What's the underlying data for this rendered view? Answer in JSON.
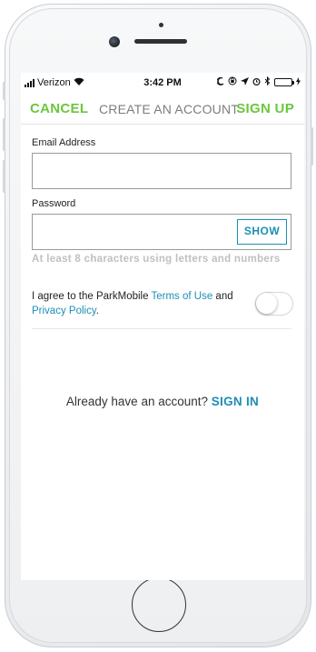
{
  "status_bar": {
    "carrier": "Verizon",
    "time": "3:42 PM",
    "icons": [
      "signal-bars-icon",
      "wifi-icon",
      "moon-icon",
      "lock-rotation-icon",
      "location-arrow-icon",
      "alarm-icon",
      "bluetooth-icon",
      "battery-icon",
      "charging-bolt-icon"
    ],
    "battery_color": "#4cd964"
  },
  "nav": {
    "cancel_label": "CANCEL",
    "title": "CREATE AN ACCOUNT",
    "signup_label": "SIGN UP",
    "accent_color": "#6cc63c"
  },
  "form": {
    "email_label": "Email Address",
    "email_value": "",
    "password_label": "Password",
    "password_value": "",
    "show_label": "SHOW",
    "password_hint": "At least 8 characters using letters and numbers",
    "agree_prefix": "I agree to the ParkMobile ",
    "terms_link": "Terms of Use",
    "agree_middle": " and ",
    "privacy_link": "Privacy Policy",
    "agree_suffix": ".",
    "agree_toggle_on": false,
    "link_color": "#1b8fb5"
  },
  "footer": {
    "question": "Already have an account? ",
    "signin_label": "SIGN IN"
  }
}
